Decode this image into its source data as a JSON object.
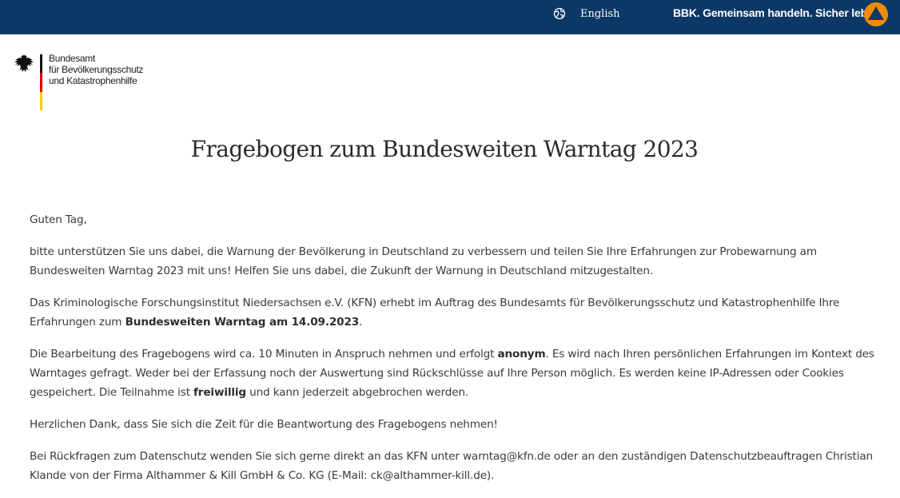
{
  "topbar": {
    "language_label": "English",
    "slogan": "BBK. Gemeinsam handeln. Sicher leben.",
    "background": "#0b3866",
    "logo_color": "#f28a00",
    "language_icon": "globe-icon"
  },
  "logo": {
    "lines": [
      "Bundesamt",
      "für Bevölkerungsschutz",
      "und Katastrophenhilfe"
    ],
    "flag_colors": [
      "#000000",
      "#dd0000",
      "#ffcc00"
    ]
  },
  "page": {
    "title": "Fragebogen zum Bundesweiten Warntag 2023"
  },
  "intro": {
    "greeting": "Guten Tag,",
    "p1": "bitte unterstützen Sie uns dabei, die Warnung der Bevölkerung in Deutschland zu verbessern und teilen Sie Ihre Erfahrungen zur Probewarnung am Bundesweiten Warntag 2023 mit uns! Helfen Sie uns dabei, die Zukunft der Warnung in Deutschland mitzugestalten.",
    "p2_a": "Das Kriminologische Forschungsinstitut Niedersachsen e.V. (KFN) erhebt im Auftrag des Bundesamts für Bevölkerungsschutz und Katastrophenhilfe Ihre Erfahrungen zum ",
    "p2_bold": "Bundesweiten Warntag am 14.09.2023",
    "p2_b": ".",
    "p3_a": "Die Bearbeitung des Fragebogens wird ca. 10 Minuten in Anspruch nehmen und erfolgt ",
    "p3_bold1": "anonym",
    "p3_b": ". Es wird nach Ihren persönlichen Erfahrungen im Kontext des Warntages gefragt. Weder bei der Erfassung noch der Auswertung sind Rückschlüsse auf Ihre Person möglich. Es werden keine IP-Adressen oder Cookies gespeichert. Die Teilnahme ist ",
    "p3_bold2": "freiwillig",
    "p3_c": " und kann jederzeit abgebrochen werden.",
    "p4": "Herzlichen Dank, dass Sie sich die Zeit für die Beantwortung des Fragebogens nehmen!",
    "p5": "Bei Rückfragen zum Datenschutz wenden Sie sich gerne direkt an das KFN unter warntag@kfn.de oder an den zuständigen Datenschutzbeauftragen Christian Klande von der Firma Althammer & Kill GmbH & Co. KG (E-Mail: ck@althammer-kill.de)."
  }
}
